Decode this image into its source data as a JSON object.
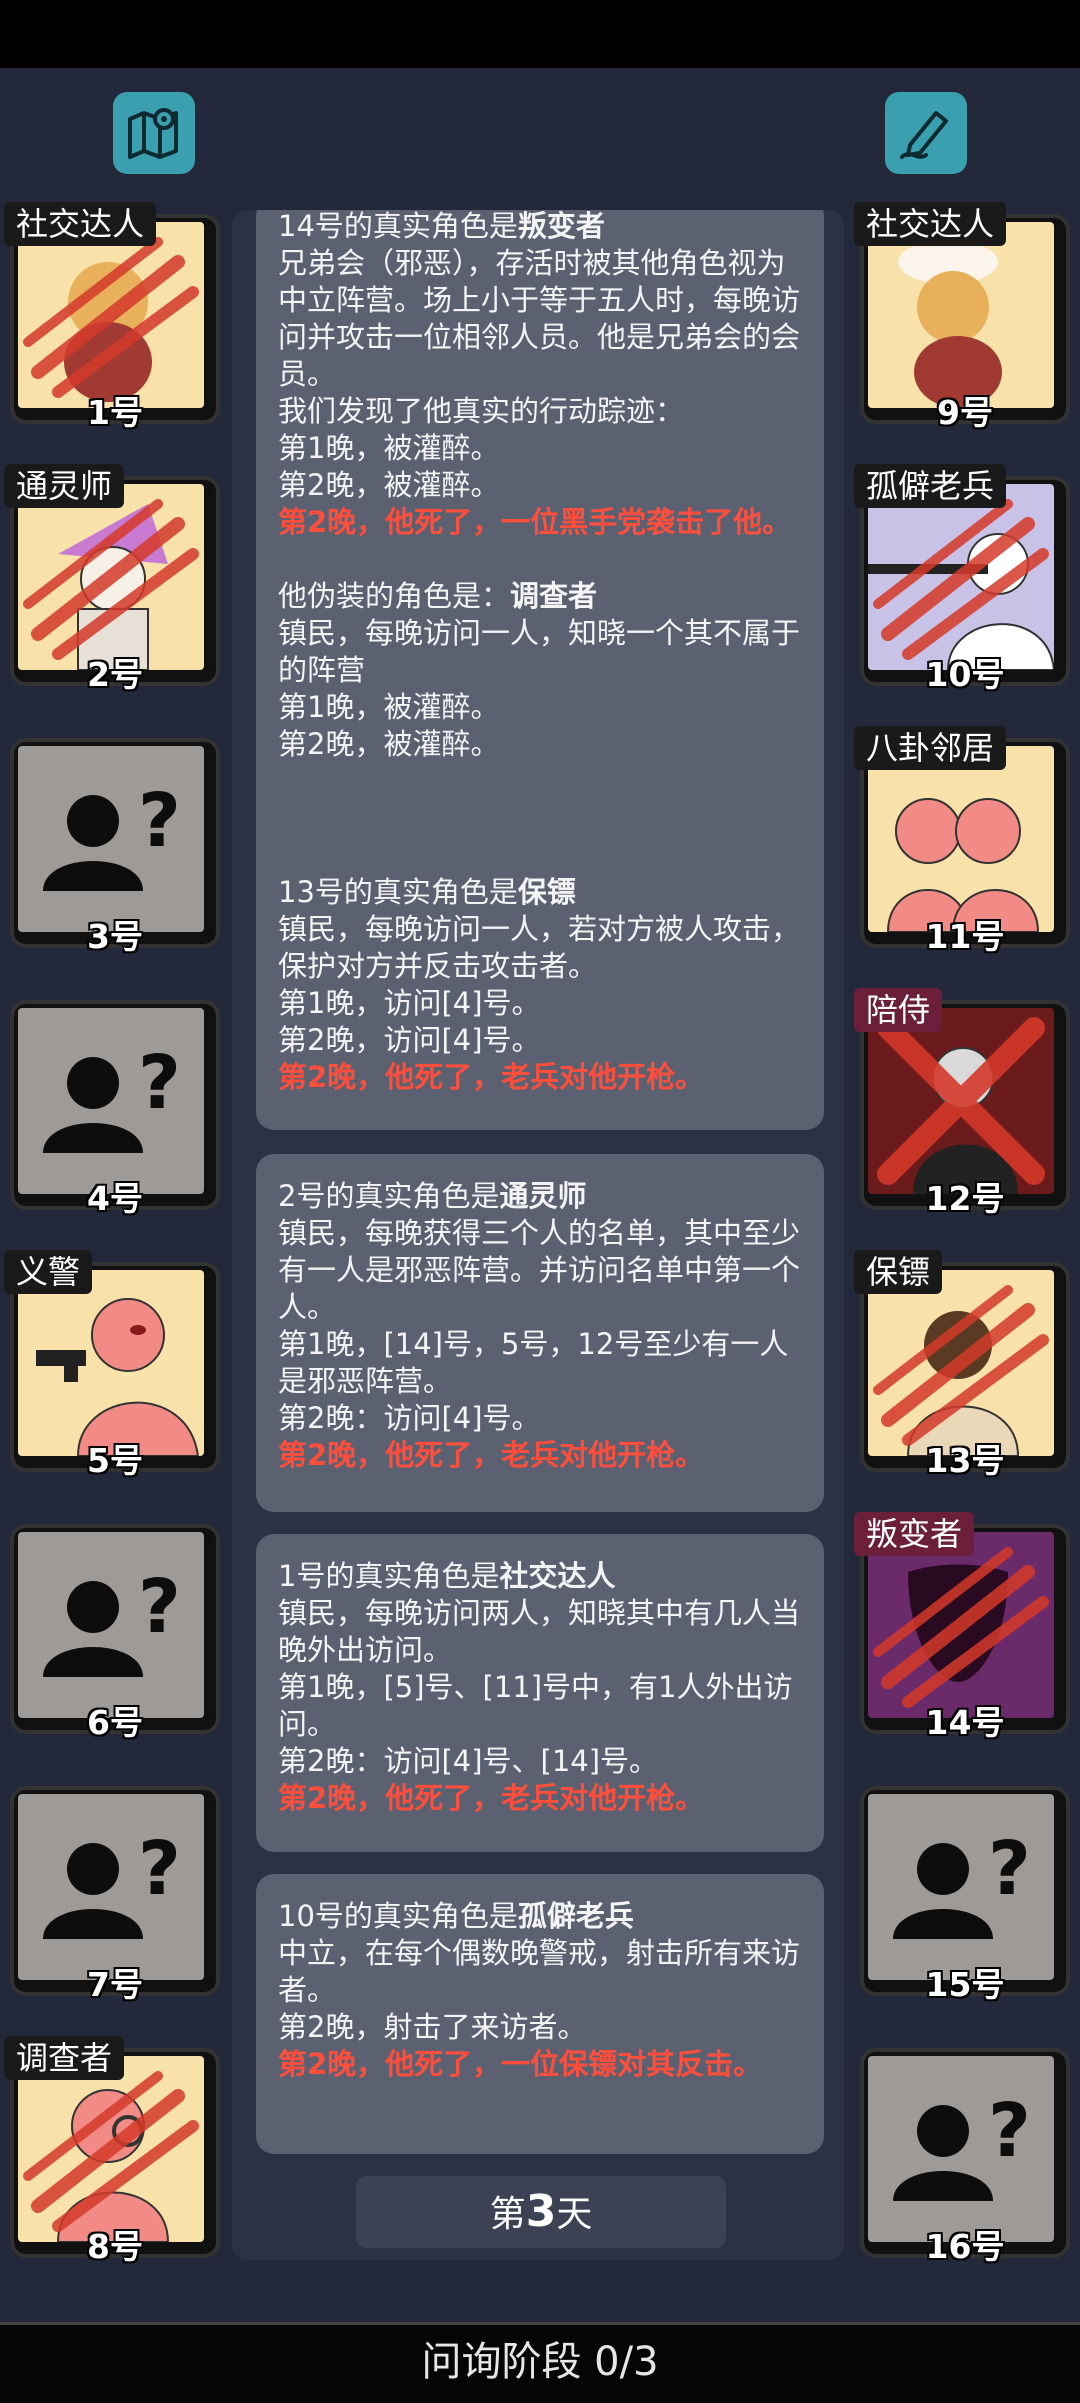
{
  "top": {
    "left_button_icon": "map-pin-icon",
    "right_button_icon": "pen-edit-icon"
  },
  "players": {
    "p1": {
      "num": "1号",
      "role": "社交达人"
    },
    "p2": {
      "num": "2号",
      "role": "通灵师"
    },
    "p3": {
      "num": "3号"
    },
    "p4": {
      "num": "4号"
    },
    "p5": {
      "num": "5号",
      "role": "义警"
    },
    "p6": {
      "num": "6号"
    },
    "p7": {
      "num": "7号"
    },
    "p8": {
      "num": "8号",
      "role": "调查者"
    },
    "p9": {
      "num": "9号",
      "role": "社交达人"
    },
    "p10": {
      "num": "10号",
      "role": "孤僻老兵"
    },
    "p11": {
      "num": "11号",
      "role": "八卦邻居"
    },
    "p12": {
      "num": "12号",
      "role": "陪侍"
    },
    "p13": {
      "num": "13号",
      "role": "保镖"
    },
    "p14": {
      "num": "14号",
      "role": "叛变者"
    },
    "p15": {
      "num": "15号"
    },
    "p16": {
      "num": "16号"
    }
  },
  "cards": {
    "c14": {
      "title_prefix": "14号的真实角色是",
      "title_role": "叛变者",
      "lines": [
        "兄弟会（邪恶），存活时被其他角色视为中立阵营。场上小于等于五人时，每晚访问并攻击一位相邻人员。他是兄弟会的会员。",
        "我们发现了他真实的行动踪迹：",
        "第1晚，被灌醉。",
        "第2晚，被灌醉。"
      ],
      "death": "第2晚，他死了，一位黑手党袭击了他。",
      "fake_prefix": "他伪装的角色是：",
      "fake_role": "调查者",
      "fake_lines": [
        "镇民，每晚访问一人，知晓一个其不属于的阵营",
        "第1晚，被灌醉。",
        "第2晚，被灌醉。"
      ]
    },
    "c13": {
      "title_prefix": "13号的真实角色是",
      "title_role": "保镖",
      "lines": [
        "镇民，每晚访问一人，若对方被人攻击，保护对方并反击攻击者。",
        "第1晚，访问[4]号。",
        "第2晚，访问[4]号。"
      ],
      "death": "第2晚，他死了，老兵对他开枪。"
    },
    "c2": {
      "title_prefix": "2号的真实角色是",
      "title_role": "通灵师",
      "lines": [
        "镇民，每晚获得三个人的名单，其中至少有一人是邪恶阵营。并访问名单中第一个人。",
        "第1晚，[14]号，5号，12号至少有一人是邪恶阵营。",
        "第2晚：访问[4]号。"
      ],
      "death": "第2晚，他死了，老兵对他开枪。"
    },
    "c1": {
      "title_prefix": "1号的真实角色是",
      "title_role": "社交达人",
      "lines": [
        "镇民，每晚访问两人，知晓其中有几人当晚外出访问。",
        "第1晚，[5]号、[11]号中，有1人外出访问。",
        "第2晚：访问[4]号、[14]号。"
      ],
      "death": "第2晚，他死了，老兵对他开枪。"
    },
    "c10": {
      "title_prefix": "10号的真实角色是",
      "title_role": "孤僻老兵",
      "lines": [
        "中立，在每个偶数晚警戒，射击所有来访者。",
        "第2晚，射击了来访者。"
      ],
      "death": "第2晚，他死了，一位保镖对其反击。"
    }
  },
  "day": {
    "prefix": "第",
    "number": "3",
    "suffix": "天"
  },
  "phase": {
    "label": "问询阶段 0/3"
  },
  "colors": {
    "accent": "#3a9fae",
    "death_text": "#ff4f3c",
    "card_bg": "#5c6172",
    "page_bg": "#23283a"
  }
}
